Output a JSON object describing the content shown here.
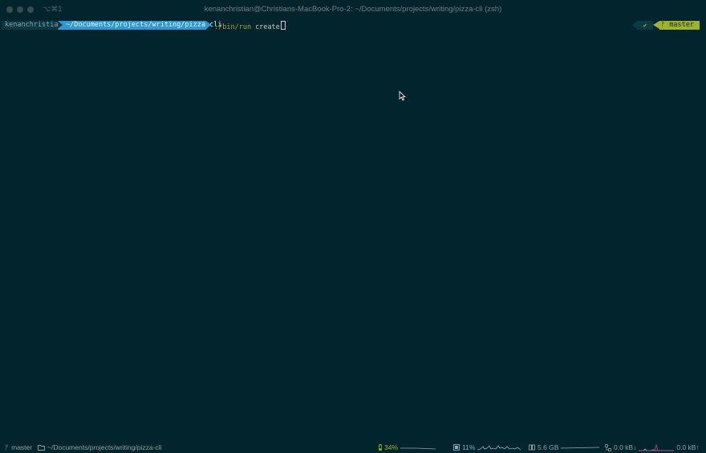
{
  "window": {
    "shortcut": "⌥⌘1",
    "title": "kenanchristian@Christians-MacBook-Pro-2: ~/Documents/projects/writing/pizza-cli (zsh)"
  },
  "prompt": {
    "user": "kenanchristian",
    "path": "~/Documents/projects/writing/pizza-cli",
    "command": "./bin/run",
    "argument": "create",
    "status_symbol": "✔",
    "branch_symbol": "ᚠ",
    "branch": "master"
  },
  "statusbar": {
    "branch_symbol": "ᚠ",
    "branch": "master",
    "path": "~/Documents/projects/writing/pizza-cli",
    "battery": "34%",
    "cpu": "11%",
    "memory": "5.6 GB",
    "net_down": "0.0 kB↓",
    "net_up": "0.0 kB↑"
  },
  "colors": {
    "background": "#02242c",
    "path_segment": "#2f97d4",
    "git_segment": "#9fb22d",
    "command": "#b3a53a"
  }
}
